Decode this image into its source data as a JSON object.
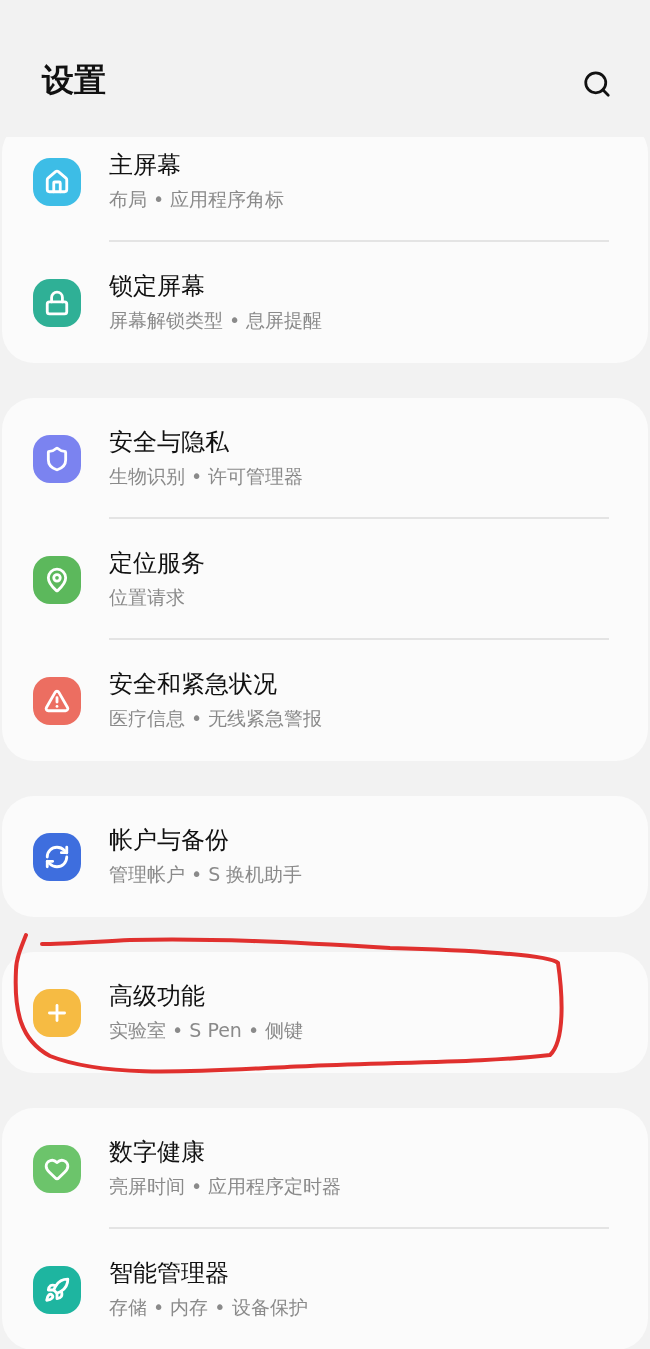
{
  "header": {
    "title": "设置"
  },
  "groups": [
    {
      "items": [
        {
          "title": "主屏幕",
          "subtitle": "布局 • 应用程序角标",
          "color": "#3dbde6",
          "annotated": false
        },
        {
          "title": "锁定屏幕",
          "subtitle": "屏幕解锁类型 • 息屏提醒",
          "color": "#2fb096",
          "annotated": false
        }
      ]
    },
    {
      "items": [
        {
          "title": "安全与隐私",
          "subtitle": "生物识别 • 许可管理器",
          "color": "#7b83f0",
          "annotated": false
        },
        {
          "title": "定位服务",
          "subtitle": "位置请求",
          "color": "#5cb85c",
          "annotated": false
        },
        {
          "title": "安全和紧急状况",
          "subtitle": "医疗信息 • 无线紧急警报",
          "color": "#ec6e61",
          "annotated": false
        }
      ]
    },
    {
      "items": [
        {
          "title": "帐户与备份",
          "subtitle": "管理帐户 • S 换机助手",
          "color": "#3e6ede",
          "annotated": false
        }
      ]
    },
    {
      "items": [
        {
          "title": "高级功能",
          "subtitle": "实验室 • S Pen • 侧键",
          "color": "#f6bb43",
          "annotated": true
        }
      ]
    },
    {
      "items": [
        {
          "title": "数字健康",
          "subtitle": "亮屏时间 • 应用程序定时器",
          "color": "#6cc46b",
          "annotated": false
        },
        {
          "title": "智能管理器",
          "subtitle": "存储 • 内存 • 设备保护",
          "color": "#1eb5a0",
          "annotated": false
        }
      ]
    }
  ]
}
